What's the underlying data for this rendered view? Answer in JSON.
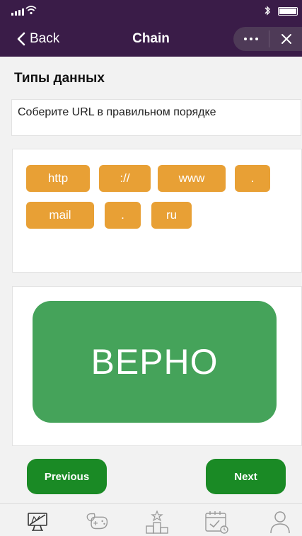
{
  "status_bar": {
    "icons": [
      "signal-icon",
      "wifi-icon",
      "bluetooth-icon",
      "battery-icon"
    ]
  },
  "nav": {
    "back_label": "Back",
    "title": "Chain",
    "icons": [
      "chevron-left-icon",
      "more-icon",
      "close-icon"
    ]
  },
  "section_title": "Типы данных",
  "instruction": "Соберите URL в правильном порядке",
  "chips": [
    "http",
    "://",
    "www",
    ".",
    "mail",
    ".",
    "ru"
  ],
  "result": {
    "text": "ВЕРНО"
  },
  "buttons": {
    "previous": "Previous",
    "next": "Next"
  },
  "tab_bar": {
    "icons": [
      "learn-icon",
      "games-icon",
      "leaderboard-icon",
      "calendar-icon",
      "profile-icon"
    ]
  },
  "colors": {
    "header": "#3a1c48",
    "chip": "#e8a035",
    "success": "#45a35a",
    "nav_button": "#1a8a25"
  }
}
